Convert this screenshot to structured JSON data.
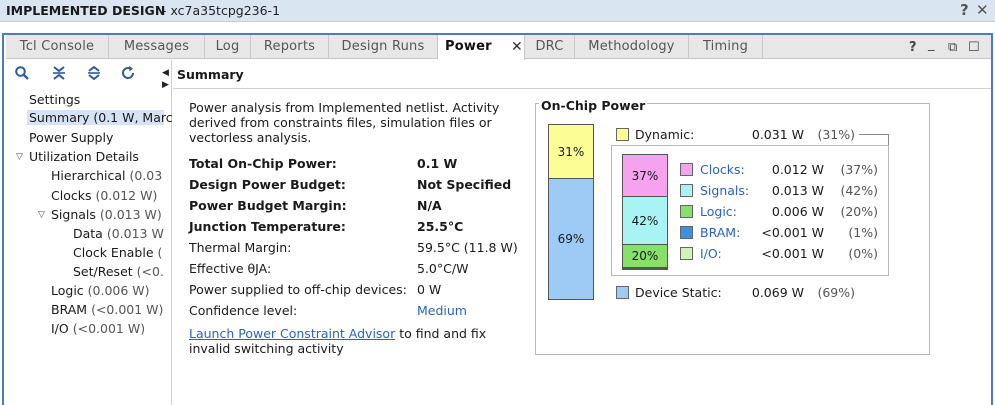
{
  "window": {
    "title": "IMPLEMENTED DESIGN",
    "part": "- xc7a35tcpg236-1",
    "help": "?",
    "close": "✕"
  },
  "tabs": [
    "Tcl Console",
    "Messages",
    "Log",
    "Reports",
    "Design Runs",
    "Power",
    "DRC",
    "Methodology",
    "Timing"
  ],
  "active_tab": "Power",
  "tab_close": "✕",
  "window_controls": {
    "help": "?",
    "minimize": "_",
    "restore": "⧉",
    "maximize": "☐"
  },
  "toolbar": {
    "search": "search-icon",
    "collapse_all": "collapse-all-icon",
    "expand_all": "expand-all-icon",
    "refresh": "refresh-icon"
  },
  "tree": {
    "settings": "Settings",
    "summary": "Summary (0.1 W, Marc",
    "power_supply": "Power Supply",
    "utilization": "Utilization Details",
    "hierarchical": {
      "label": "Hierarchical",
      "value": "(0.03"
    },
    "clocks": {
      "label": "Clocks",
      "value": "(0.012 W)"
    },
    "signals": {
      "label": "Signals",
      "value": "(0.013 W)"
    },
    "data": {
      "label": "Data",
      "value": "(0.013 W"
    },
    "clock_enable": {
      "label": "Clock Enable",
      "value": "("
    },
    "set_reset": {
      "label": "Set/Reset",
      "value": "(<0."
    },
    "logic": {
      "label": "Logic",
      "value": "(0.006 W)"
    },
    "bram": {
      "label": "BRAM",
      "value": "(<0.001 W)"
    },
    "io": {
      "label": "I/O",
      "value": "(<0.001 W)"
    }
  },
  "summary": {
    "header": "Summary",
    "description": "Power analysis from Implemented netlist. Activity derived from constraints files, simulation files or vectorless analysis.",
    "rows": [
      {
        "label": "Total On-Chip Power:",
        "value": "0.1 W",
        "bold": true
      },
      {
        "label": "Design Power Budget:",
        "value": "Not Specified",
        "bold": true
      },
      {
        "label": "Power Budget Margin:",
        "value": "N/A",
        "bold": true
      },
      {
        "label": "Junction Temperature:",
        "value": "25.5°C",
        "bold": true
      },
      {
        "label": "Thermal Margin:",
        "value": "59.5°C (11.8 W)",
        "bold": false
      },
      {
        "label": "Effective θJA:",
        "value": "5.0°C/W",
        "bold": false
      },
      {
        "label": "Power supplied to off-chip devices:",
        "value": "0 W",
        "bold": false
      },
      {
        "label": "Confidence level:",
        "value": "Medium",
        "bold": false
      }
    ],
    "advisor_link": "Launch Power Constraint Advisor",
    "advisor_text": " to find and fix invalid switching activity"
  },
  "on_chip": {
    "title": "On-Chip Power",
    "main_bar": [
      {
        "label": "31%",
        "fraction": 0.31,
        "color": "#fdfd96"
      },
      {
        "label": "69%",
        "fraction": 0.69,
        "color": "#9ecbf5"
      }
    ],
    "dynamic": {
      "label": "Dynamic:",
      "value": "0.031 W",
      "pct": "(31%)",
      "color": "#fdfd96"
    },
    "static": {
      "label": "Device Static:",
      "value": "0.069 W",
      "pct": "(69%)",
      "color": "#9ecbf5"
    },
    "sub_bar": [
      {
        "label": "37%",
        "fraction": 0.37,
        "color": "#f5a3ee"
      },
      {
        "label": "42%",
        "fraction": 0.42,
        "color": "#a8f4f4"
      },
      {
        "label": "20%",
        "fraction": 0.2,
        "color": "#86e06a"
      },
      {
        "label": "",
        "fraction": 0.01,
        "color": "#3f8fe0"
      },
      {
        "label": "",
        "fraction": 0.01,
        "color": "#d2f3b6"
      }
    ],
    "breakdown": [
      {
        "label": "Clocks:",
        "value": "0.012 W",
        "pct": "(37%)",
        "color": "#f5a3ee"
      },
      {
        "label": "Signals:",
        "value": "0.013 W",
        "pct": "(42%)",
        "color": "#a8f4f4"
      },
      {
        "label": "Logic:",
        "value": "0.006 W",
        "pct": "(20%)",
        "color": "#86e06a"
      },
      {
        "label": "BRAM:",
        "value": "<0.001 W",
        "pct": "(1%)",
        "color": "#3f8fe0"
      },
      {
        "label": "I/O:",
        "value": "<0.001 W",
        "pct": "(0%)",
        "color": "#d2f3b6"
      }
    ]
  }
}
